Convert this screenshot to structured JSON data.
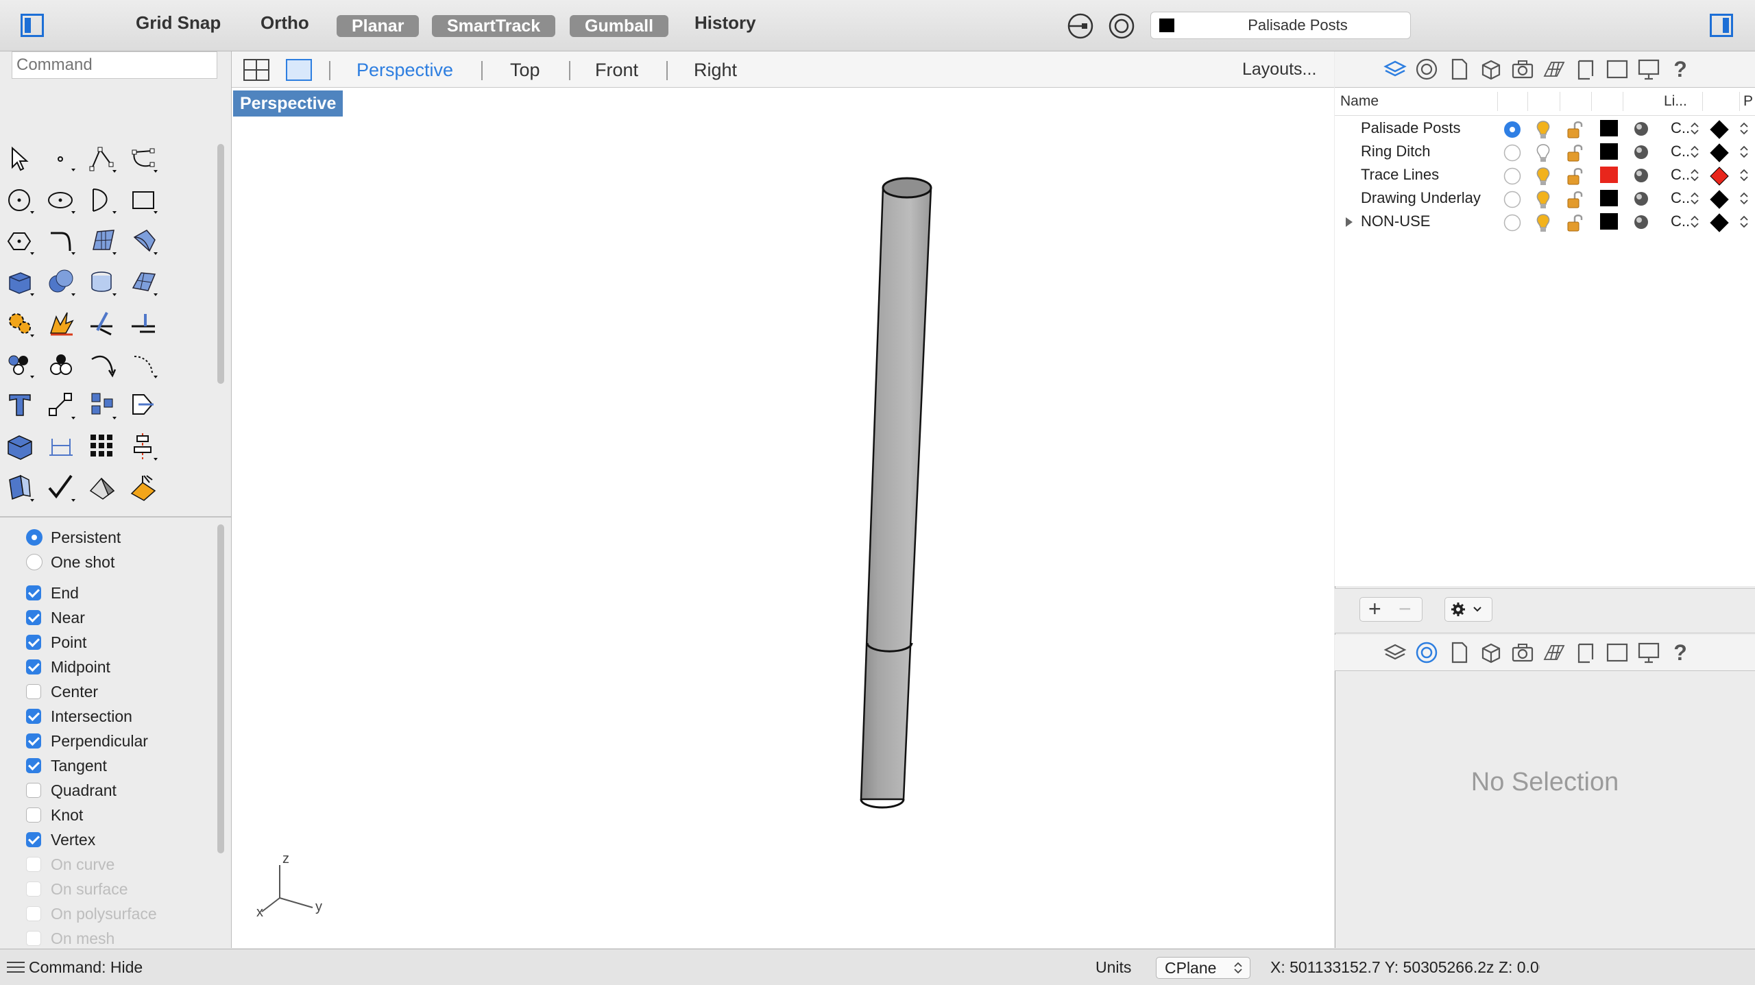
{
  "topbar": {
    "grid_snap": "Grid Snap",
    "ortho": "Ortho",
    "planar": "Planar",
    "smarttrack": "SmartTrack",
    "gumball": "Gumball",
    "history": "History",
    "current_layer": "Palisade Posts"
  },
  "command": {
    "placeholder": "Command"
  },
  "viewport": {
    "tabs": [
      "Perspective",
      "Top",
      "Front",
      "Right"
    ],
    "active_tab": "Perspective",
    "layouts_label": "Layouts...",
    "label": "Perspective",
    "axis_z": "z",
    "axis_y": "y",
    "axis_x": "x"
  },
  "osnap": {
    "mode_persistent": "Persistent",
    "mode_one_shot": "One shot",
    "items": [
      {
        "label": "End",
        "checked": true
      },
      {
        "label": "Near",
        "checked": true
      },
      {
        "label": "Point",
        "checked": true
      },
      {
        "label": "Midpoint",
        "checked": true
      },
      {
        "label": "Center",
        "checked": false
      },
      {
        "label": "Intersection",
        "checked": true
      },
      {
        "label": "Perpendicular",
        "checked": true
      },
      {
        "label": "Tangent",
        "checked": true
      },
      {
        "label": "Quadrant",
        "checked": false
      },
      {
        "label": "Knot",
        "checked": false
      },
      {
        "label": "Vertex",
        "checked": true
      },
      {
        "label": "On curve",
        "checked": false,
        "disabled": true
      },
      {
        "label": "On surface",
        "checked": false,
        "disabled": true
      },
      {
        "label": "On polysurface",
        "checked": false,
        "disabled": true
      },
      {
        "label": "On mesh",
        "checked": false,
        "disabled": true
      }
    ]
  },
  "layers": {
    "col_name": "Name",
    "col_linetype": "Li...",
    "col_print": "P",
    "rows": [
      {
        "name": "Palisade Posts",
        "current": true,
        "on": true,
        "color": "#000000",
        "linetype": "C..",
        "print_color": "#000000"
      },
      {
        "name": "Ring Ditch",
        "current": false,
        "on": false,
        "color": "#000000",
        "linetype": "C..",
        "print_color": "#000000"
      },
      {
        "name": "Trace Lines",
        "current": false,
        "on": true,
        "color": "#e8261c",
        "linetype": "C..",
        "print_color": "#e8261c"
      },
      {
        "name": "Drawing Underlay",
        "current": false,
        "on": true,
        "color": "#000000",
        "linetype": "C..",
        "print_color": "#000000"
      },
      {
        "name": "NON-USE",
        "current": false,
        "on": true,
        "color": "#000000",
        "linetype": "C..",
        "print_color": "#000000",
        "expandable": true
      }
    ],
    "add": "+",
    "remove": "−"
  },
  "properties": {
    "no_selection": "No Selection"
  },
  "statusbar": {
    "command_history": "Command: Hide",
    "units": "Units",
    "cplane": "CPlane",
    "coords": "X: 501133152.7 Y: 50305266.2z Z: 0.00"
  },
  "colors": {
    "accent": "#2f7fe4",
    "viewport_label": "#4f84bf"
  }
}
